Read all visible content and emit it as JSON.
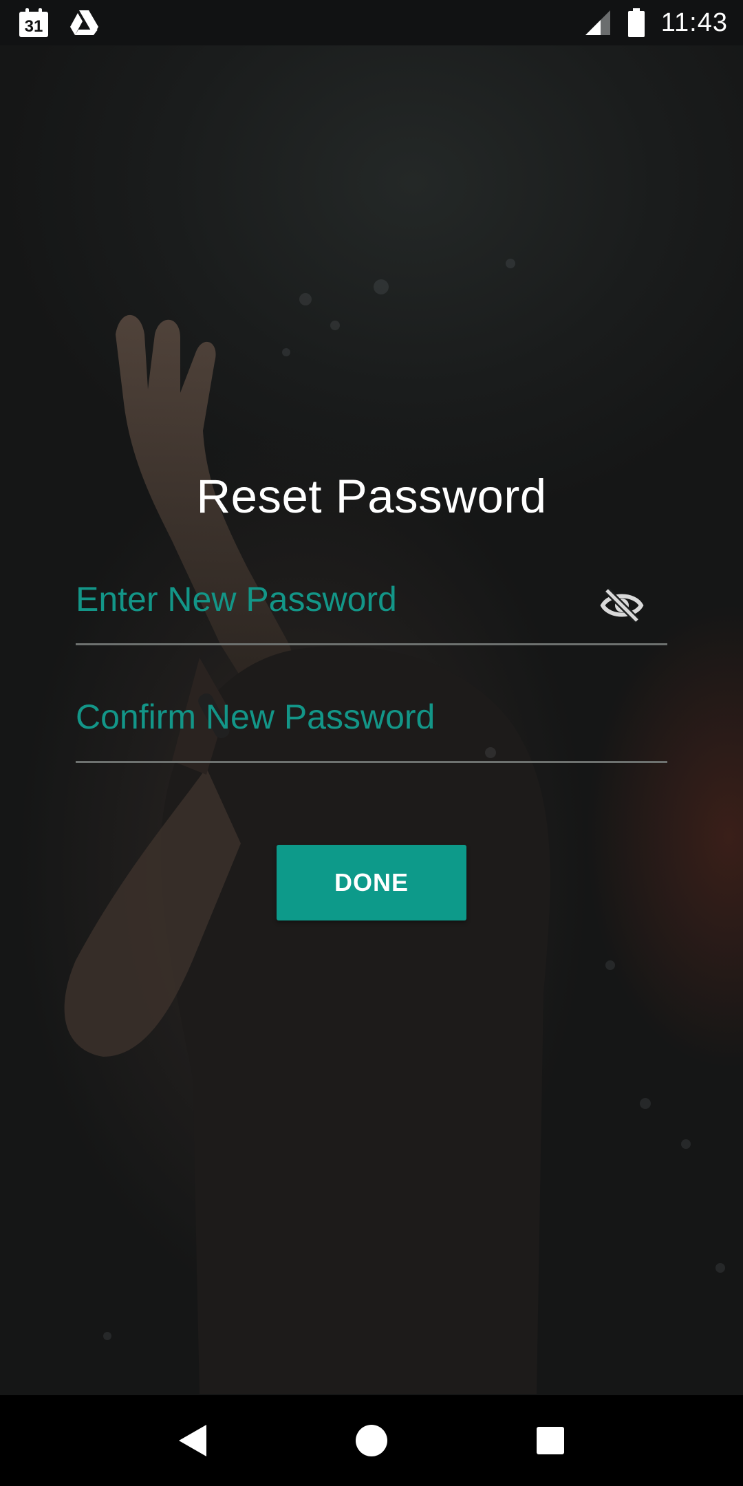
{
  "status_bar": {
    "calendar_day": "31",
    "time": "11:43",
    "icons": [
      "calendar-icon",
      "drive-icon",
      "signal-icon",
      "battery-icon"
    ]
  },
  "form": {
    "title": "Reset Password",
    "new_password_placeholder": "Enter New Password",
    "confirm_password_placeholder": "Confirm New Password",
    "done_label": "DONE",
    "visibility_icon": "visibility-off-icon"
  },
  "colors": {
    "accent": "#0d9a8a",
    "placeholder": "#139688",
    "underline": "#6e7270"
  },
  "nav_bar": {
    "icons": [
      "back-icon",
      "home-icon",
      "recents-icon"
    ]
  }
}
